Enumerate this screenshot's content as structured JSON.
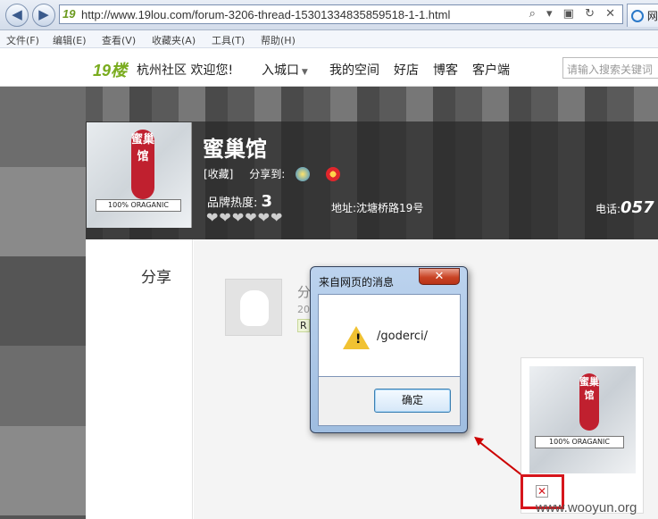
{
  "browser": {
    "back_icon": "back-arrow-icon",
    "forward_icon": "forward-arrow-icon",
    "url": "http://www.19lou.com/forum-3206-thread-15301334835859518-1-1.html",
    "url_icons": "⌕ ▾ ▣ ↻ ✕",
    "tab_title": "网"
  },
  "menu": [
    "文件(F)",
    "编辑(E)",
    "查看(V)",
    "收藏夹(A)",
    "工具(T)",
    "帮助(H)"
  ],
  "site": {
    "logo_text": "19楼",
    "welcome": "杭州社区 欢迎您!",
    "enter_city": "入城口",
    "nav": [
      "我的空间",
      "好店",
      "博客",
      "客户端"
    ],
    "search_placeholder": "请输入搜索关键词"
  },
  "shop": {
    "logo_seal": "蜜巢馆",
    "logo_band": "100% ORAGANIC",
    "name": "蜜巢馆",
    "favorite": "[收藏]",
    "share_to": "分享到:",
    "heat_label": "品牌热度:",
    "heat_value": "3",
    "hearts": "❤❤❤❤❤❤",
    "address": "地址:沈塘桥路19号",
    "phone_label": "电话:",
    "phone_value": "057"
  },
  "content": {
    "section_title": "分享",
    "post_title": "分",
    "post_date": "20",
    "post_tag": "R"
  },
  "dialog": {
    "title": "来自网页的消息",
    "close": "✕",
    "message": "/goderci/",
    "ok": "确定"
  },
  "watermark": "www.wooyun.org"
}
